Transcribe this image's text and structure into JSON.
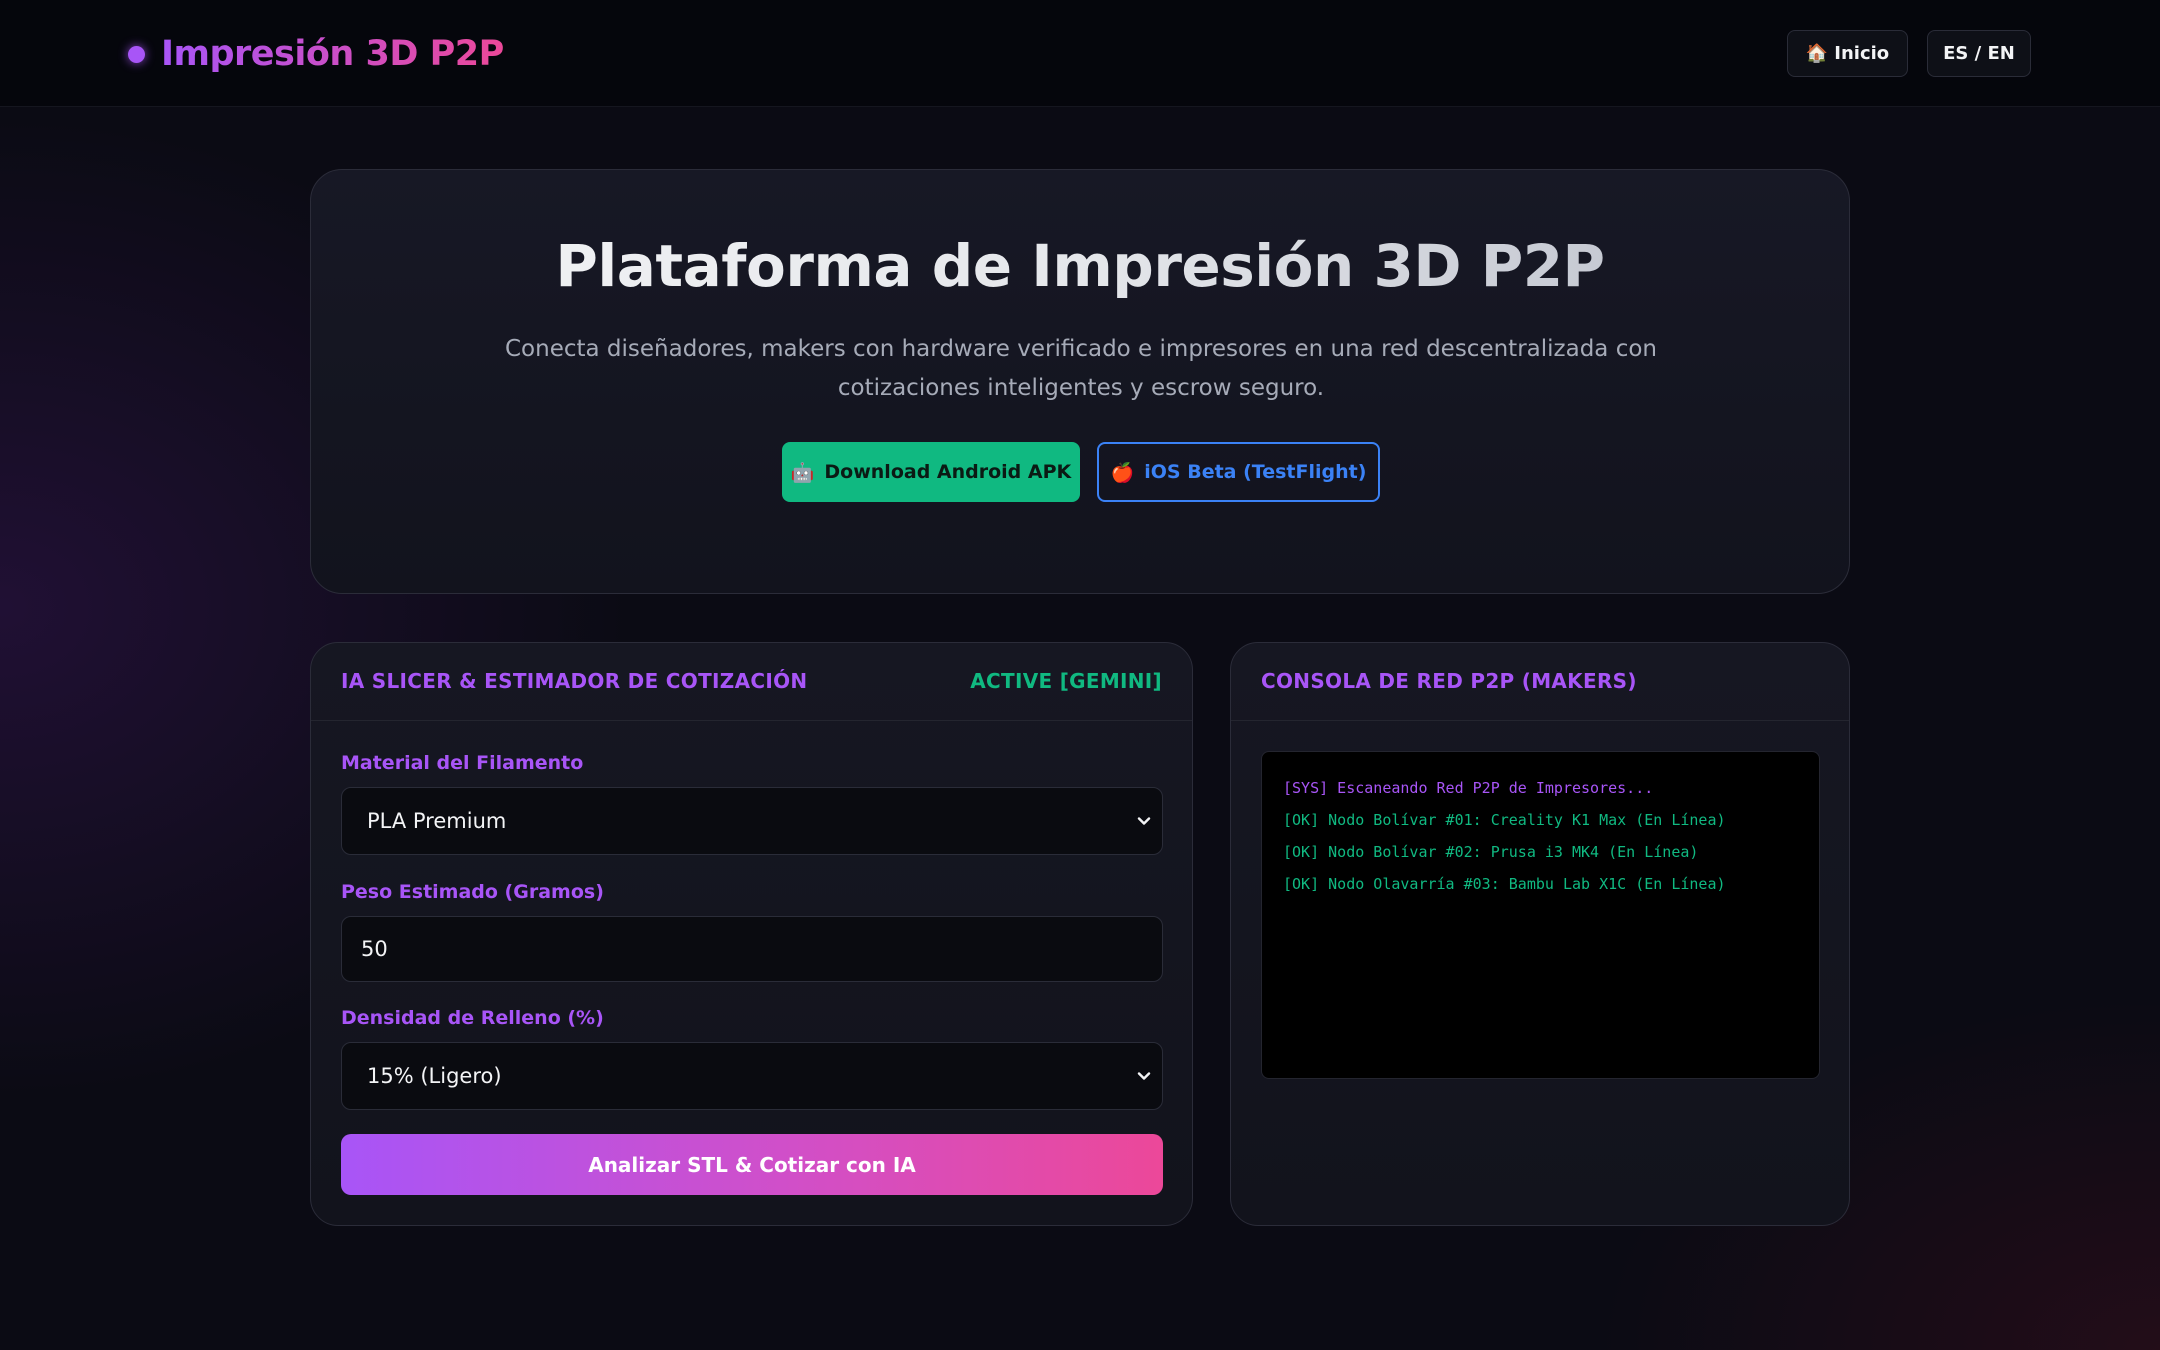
{
  "header": {
    "brand": "Impresión 3D P2P",
    "nav": {
      "home_icon": "🏠",
      "home_label": "Inicio",
      "lang_label": "ES / EN"
    }
  },
  "hero": {
    "title": "Plataforma de Impresión 3D P2P",
    "subtitle": "Conecta diseñadores, makers con hardware verificado e impresores en una red descentralizada con cotizaciones inteligentes y escrow seguro.",
    "android_icon": "🤖",
    "android_label": "Download Android APK",
    "ios_icon": "🍎",
    "ios_label": "iOS Beta (TestFlight)"
  },
  "estimator": {
    "title": "IA SLICER & ESTIMADOR DE COTIZACIÓN",
    "status": "ACTIVE [GEMINI]",
    "material_label": "Material del Filamento",
    "material_value": "PLA Premium",
    "weight_label": "Peso Estimado (Gramos)",
    "weight_value": "50",
    "infill_label": "Densidad de Relleno (%)",
    "infill_value": "15% (Ligero)",
    "cta_label": "Analizar STL & Cotizar con IA"
  },
  "console": {
    "title": "CONSOLA DE RED P2P (MAKERS)",
    "lines": [
      "[SYS] Escaneando Red P2P de Impresores...",
      "[OK] Nodo Bolívar #01: Creality K1 Max (En Línea)",
      "[OK] Nodo Bolívar #02: Prusa i3 MK4 (En Línea)",
      "[OK] Nodo Olavarría #03: Bambu Lab X1C (En Línea)"
    ]
  },
  "colors": {
    "accent_purple": "#a855f7",
    "accent_pink": "#ec4899",
    "success_green": "#10b981",
    "ios_blue": "#3b82f6"
  }
}
